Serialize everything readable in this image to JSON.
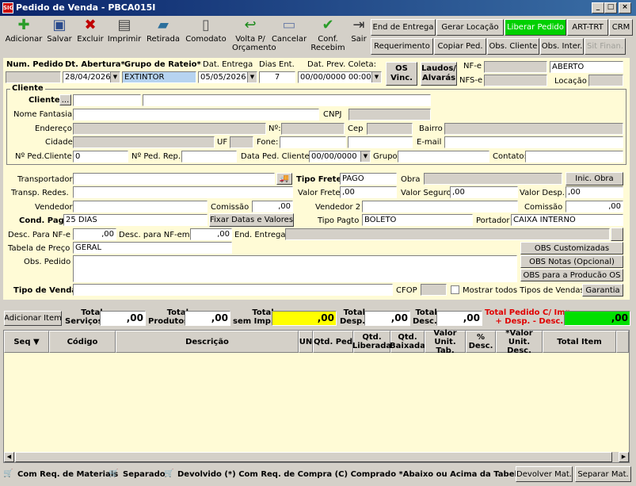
{
  "window": {
    "title": "Pedido de Venda - PBCA015I",
    "app_icon": "SIG",
    "min": "_",
    "max": "□",
    "close": "×"
  },
  "toolbar": [
    {
      "label": "Adicionar",
      "icon": "add-icon",
      "color": "#2a9d2a"
    },
    {
      "label": "Salvar",
      "icon": "save-icon",
      "color": "#2b4b8c"
    },
    {
      "label": "Excluir",
      "icon": "delete-icon",
      "color": "#c00000"
    },
    {
      "label": "Imprimir",
      "icon": "print-icon",
      "color": "#444"
    },
    {
      "label": "Retirada",
      "icon": "truck-icon",
      "color": "#2b6f9c"
    },
    {
      "label": "Comodato",
      "icon": "document-icon",
      "color": "#555"
    },
    {
      "label": "Volta P/\nOrçamento",
      "icon": "return-icon",
      "color": "#1a8a1a"
    },
    {
      "label": "Cancelar",
      "icon": "cancel-icon",
      "color": "#6e7fa8"
    },
    {
      "label": "Conf.\nRecebim",
      "icon": "check-icon",
      "color": "#2a9d2a"
    },
    {
      "label": "Sair",
      "icon": "exit-icon",
      "color": "#333"
    }
  ],
  "top_buttons": {
    "end_entrega": "End de Entrega",
    "gerar_locacao": "Gerar Locação",
    "liberar_pedido": "Liberar Pedido",
    "art_trt": "ART-TRT",
    "crm": "CRM",
    "requerimento": "Requerimento",
    "copiar_ped": "Copiar Ped.",
    "obs_cliente": "Obs. Cliente",
    "obs_inter": "Obs. Inter.",
    "sit_finan": "Sit Finan."
  },
  "header": {
    "num_pedido_label": "Num. Pedido",
    "dt_abertura_label": "Dt. Abertura*",
    "grupo_rateio_label": "Grupo de Rateio*",
    "dat_entrega_label": "Dat. Entrega",
    "dias_ent_label": "Dias Ent.",
    "dat_prev_label": "Dat. Prev. Coleta:",
    "num_pedido": "",
    "dt_abertura": "28/04/2026",
    "grupo_rateio": "EXTINTOR",
    "dat_entrega": "05/05/2026",
    "dias_ent": "7",
    "dat_prev": "00/00/0000 00:00",
    "os_vinc": "OS\nVinc.",
    "laudos": "Laudos/\nAlvarás",
    "nfe_label": "NF-e",
    "nfse_label": "NFS-e",
    "status": "ABERTO",
    "locacao_label": "Locação"
  },
  "cliente": {
    "group_label": "Cliente",
    "cliente_label": "Cliente*",
    "nome_fantasia_label": "Nome Fantasia",
    "cnpj_label": "CNPJ",
    "endereco_label": "Endereço",
    "numero_label": "Nº:",
    "cep_label": "Cep",
    "bairro_label": "Bairro",
    "cidade_label": "Cidade",
    "uf_label": "UF",
    "fone_label": "Fone:",
    "email_label": "E-mail",
    "nped_cliente_label": "Nº Ped.Cliente",
    "nped_cliente": "0",
    "nped_rep_label": "Nº Ped. Rep.",
    "data_ped_label": "Data Ped. Cliente",
    "data_ped": "00/00/0000",
    "grupo_label": "Grupo:",
    "contato_label": "Contato:",
    "browse": "..."
  },
  "detalhes": {
    "transportador": "Transportador",
    "tipo_frete_label": "Tipo Frete*",
    "tipo_frete": "PAGO",
    "obra_label": "Obra",
    "inic_obra": "Inic. Obra",
    "transp_redes": "Transp. Redes.",
    "valor_frete_label": "Valor Frete",
    "valor_frete": ",00",
    "valor_seguro_label": "Valor Seguro",
    "valor_seguro": ",00",
    "valor_desp_label": "Valor Desp.",
    "valor_desp": ",00",
    "vendedor_label": "Vendedor",
    "comissao_label": "Comissão",
    "comissao": ",00",
    "vendedor2_label": "Vendedor 2",
    "comissao2_label": "Comissão",
    "comissao2": ",00",
    "cond_pagto_label": "Cond. Pagto.*",
    "cond_pagto": "25 DIAS",
    "fixar": "Fixar Datas e Valores",
    "tipo_pagto_label": "Tipo Pagto",
    "tipo_pagto": "BOLETO",
    "portador_label": "Portador",
    "portador": "CAIXA INTERNO",
    "desc_nfe_label": "Desc. Para NF-e",
    "desc_nfe": ",00",
    "desc_nfem_label": "Desc. para NF-em",
    "desc_nfem": ",00",
    "end_entrega_label": "End. Entrega",
    "tabela_preco_label": "Tabela de Preço",
    "tabela_preco": "GERAL",
    "obs_custom": "OBS Customizadas",
    "obs_pedido_label": "Obs. Pedido",
    "obs_notas": "OBS Notas (Opcional)",
    "obs_producao": "OBS para a Producão OS",
    "tipo_venda_label": "Tipo de Venda*",
    "cfop_label": "CFOP",
    "mostrar_todos": "Mostrar todos Tipos de Vendas",
    "garantia": "Garantia"
  },
  "totais": {
    "adicionar_item": "Adicionar Item",
    "total_servicos": "Total\nServiços",
    "total_servicos_v": ",00",
    "total_produtos": "Total\nProdutos",
    "total_produtos_v": ",00",
    "total_sem_imp": "Total\nsem Imp.",
    "total_sem_imp_v": ",00",
    "total_desp": "Total\nDesp.",
    "total_desp_v": ",00",
    "total_desc": "Total\nDesc.",
    "total_desc_v": ",00",
    "total_pedido": "Total Pedido C/ Imp.\n+ Desp. - Desc.",
    "total_pedido_v": ",00"
  },
  "grid_columns": [
    "Seq ▼",
    "Código",
    "Descrição",
    "UN",
    "Qtd. Ped",
    "Qtd.\nLiberada",
    "Qtd.\nBaixada",
    "Valor Unit.\nTab.",
    "%\nDesc.",
    "*Valor Unit.\nDesc.",
    "Total Item"
  ],
  "legend": {
    "com_req": "Com Req. de Materiais",
    "separado": "Separado",
    "devolvido": "Devolvido (*) Com Req. de Compra  (C) Comprado *Abaixo ou Acima da Tabela Preço",
    "devolver_mat": "Devolver Mat.",
    "separar_mat": "Separar Mat."
  }
}
